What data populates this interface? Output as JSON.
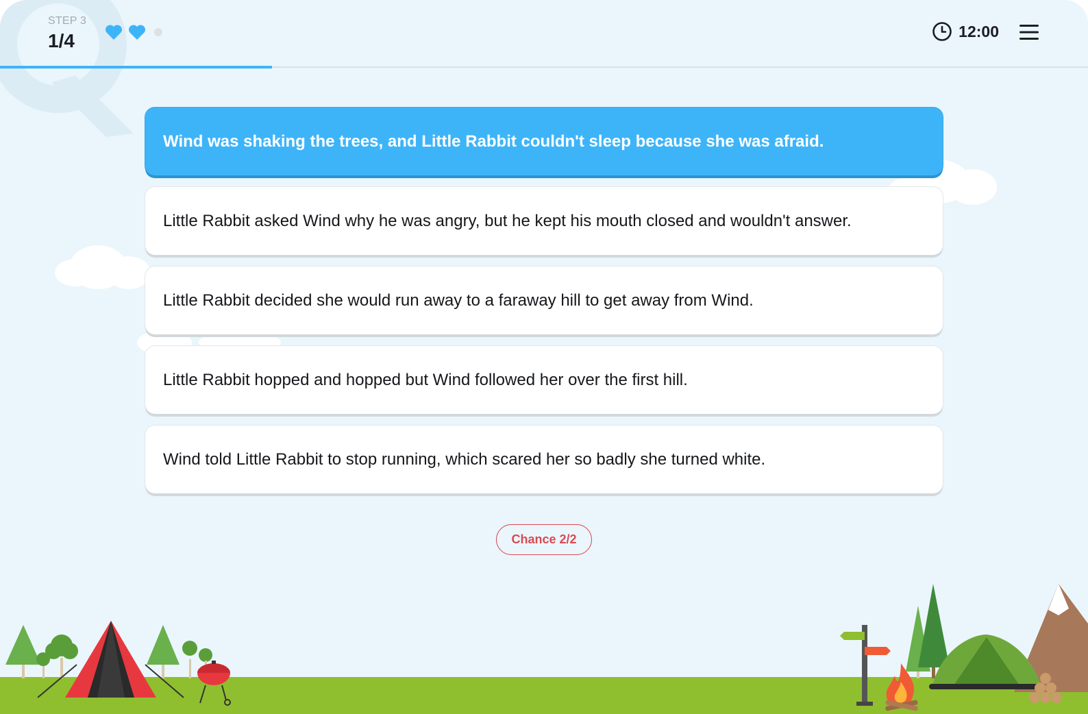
{
  "header": {
    "step_label": "STEP 3",
    "progress": "1/4",
    "lives": {
      "full": 2,
      "total": 3
    },
    "timer": "12:00",
    "progress_fraction": 0.25
  },
  "options": [
    {
      "text": "Wind was shaking the trees, and Little Rabbit couldn't sleep because she was afraid.",
      "selected": true
    },
    {
      "text": "Little Rabbit asked Wind why he was angry, but he kept his mouth closed and wouldn't answer.",
      "selected": false
    },
    {
      "text": "Little Rabbit decided she would run away to a faraway hill to get away from Wind.",
      "selected": false
    },
    {
      "text": "Little Rabbit hopped and hopped but Wind followed her over the first hill.",
      "selected": false
    },
    {
      "text": "Wind told Little Rabbit to stop running, which scared her so badly she turned white.",
      "selected": false
    }
  ],
  "chance": "Chance 2/2",
  "colors": {
    "accent": "#3eb4f8",
    "background": "#eaf6fc",
    "chance": "#d94a52",
    "grass": "#8fbf2f"
  },
  "icons": {
    "lives": "heart-icon",
    "timer": "clock-icon",
    "menu": "hamburger-menu-icon"
  }
}
